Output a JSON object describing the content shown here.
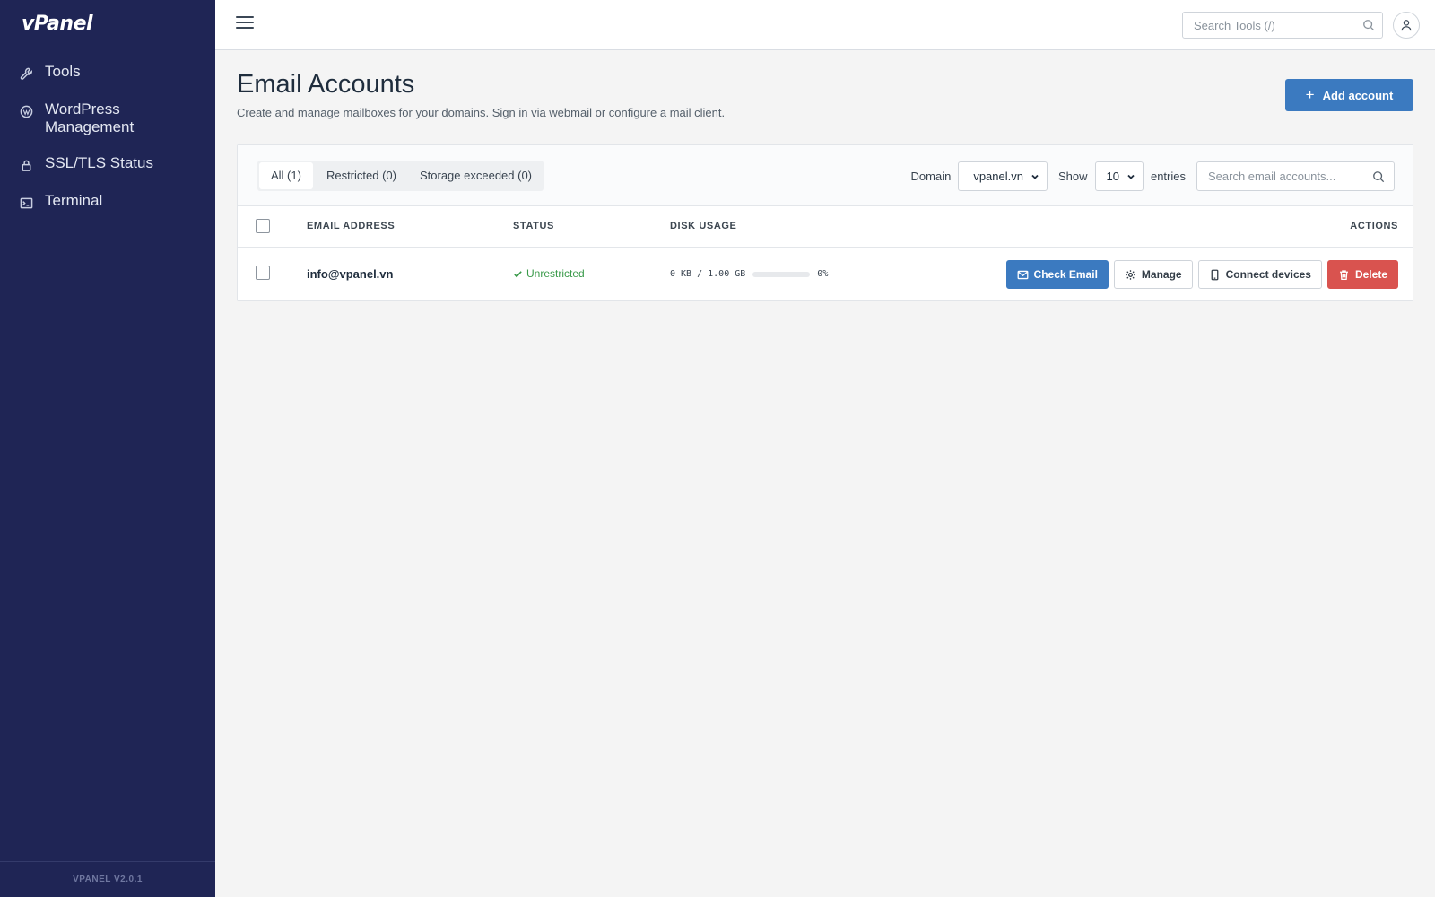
{
  "app": {
    "logo": "vPanel",
    "version": "VPANEL V2.0.1"
  },
  "sidebar": {
    "items": [
      {
        "label": "Tools",
        "icon": "wrench-icon"
      },
      {
        "label": "WordPress Management",
        "icon": "wordpress-icon"
      },
      {
        "label": "SSL/TLS Status",
        "icon": "lock-icon"
      },
      {
        "label": "Terminal",
        "icon": "terminal-icon"
      }
    ]
  },
  "topbar": {
    "search_placeholder": "Search Tools (/)"
  },
  "page": {
    "title": "Email Accounts",
    "description": "Create and manage mailboxes for your domains. Sign in via webmail or configure a mail client.",
    "add_label": "Add account"
  },
  "tabs": [
    {
      "label": "All (1)",
      "active": true
    },
    {
      "label": "Restricted (0)",
      "active": false
    },
    {
      "label": "Storage exceeded (0)",
      "active": false
    }
  ],
  "filters": {
    "domain_label": "Domain",
    "domain_value": "vpanel.vn",
    "show_label": "Show",
    "show_value": "10",
    "entries_label": "entries",
    "search_placeholder": "Search email accounts..."
  },
  "table": {
    "headers": {
      "email": "EMAIL ADDRESS",
      "status": "STATUS",
      "disk": "DISK USAGE",
      "actions": "ACTIONS"
    },
    "rows": [
      {
        "email": "info@vpanel.vn",
        "status": "Unrestricted",
        "disk_text": "0 KB / 1.00 GB",
        "disk_percent": "0%",
        "disk_fraction": 0,
        "actions": {
          "check": "Check Email",
          "manage": "Manage",
          "connect": "Connect devices",
          "delete": "Delete"
        }
      }
    ]
  },
  "colors": {
    "sidebar": "#1f2555",
    "primary": "#3b7ac0",
    "danger": "#d9534f",
    "success": "#3a9a4a"
  }
}
